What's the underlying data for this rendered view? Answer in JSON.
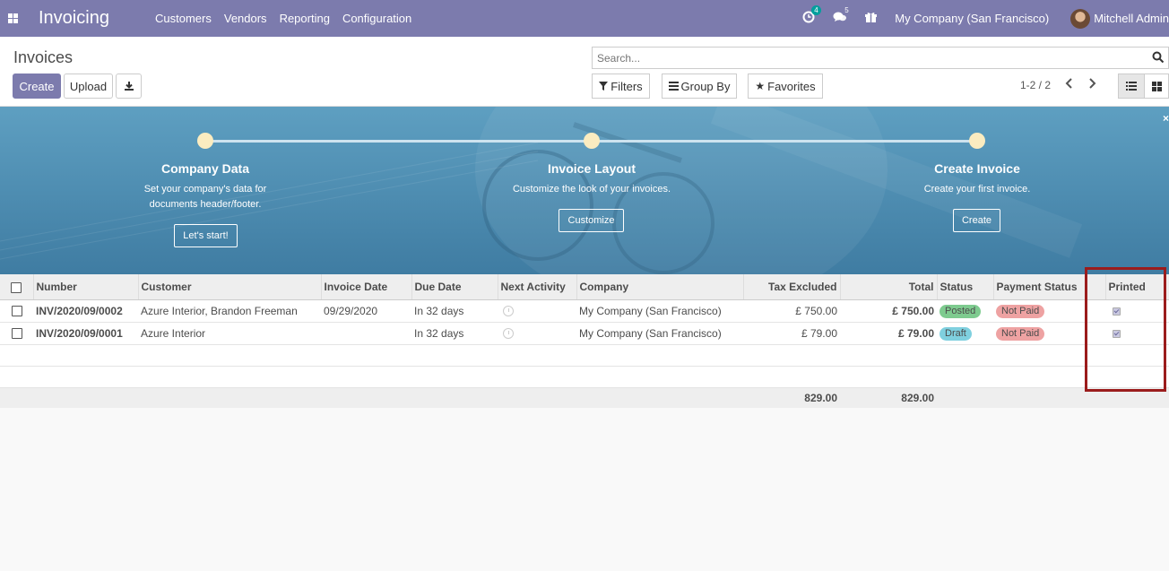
{
  "navbar": {
    "app_title": "Invoicing",
    "menu": [
      "Customers",
      "Vendors",
      "Reporting",
      "Configuration"
    ],
    "activity_count": "4",
    "messages_count": "5",
    "company": "My Company (San Francisco)",
    "user": "Mitchell Admin",
    "accent": "#7c7bad"
  },
  "control": {
    "breadcrumb": "Invoices",
    "create_label": "Create",
    "upload_label": "Upload",
    "search_placeholder": "Search...",
    "filters_label": "Filters",
    "groupby_label": "Group By",
    "favorites_label": "Favorites",
    "pager": "1-2 / 2"
  },
  "banner": {
    "steps": [
      {
        "title": "Company Data",
        "text1": "Set your company's data for",
        "text2": "documents header/footer.",
        "button": "Let's start!"
      },
      {
        "title": "Invoice Layout",
        "text1": "Customize the look of your invoices.",
        "button": "Customize"
      },
      {
        "title": "Create Invoice",
        "text1": "Create your first invoice.",
        "button": "Create"
      }
    ],
    "close": "×"
  },
  "table": {
    "headers": [
      "Number",
      "Customer",
      "Invoice Date",
      "Due Date",
      "Next Activity",
      "Company",
      "Tax Excluded",
      "Total",
      "Status",
      "Payment Status",
      "Printed"
    ],
    "rows": [
      {
        "number": "INV/2020/09/0002",
        "customer": "Azure Interior, Brandon Freeman",
        "invoice_date": "09/29/2020",
        "due_date": "In 32 days",
        "company": "My Company (San Francisco)",
        "tax_excluded": "£ 750.00",
        "total": "£ 750.00",
        "status": "Posted",
        "payment_status": "Not Paid",
        "printed": true
      },
      {
        "number": "INV/2020/09/0001",
        "customer": "Azure Interior",
        "invoice_date": "",
        "due_date": "In 32 days",
        "company": "My Company (San Francisco)",
        "tax_excluded": "£ 79.00",
        "total": "£ 79.00",
        "status": "Draft",
        "payment_status": "Not Paid",
        "printed": true
      }
    ],
    "footer": {
      "tax_excluded": "829.00",
      "total": "829.00"
    },
    "colors": {
      "posted": "#7ecb8f",
      "draft": "#7fd0df",
      "not_paid": "#eea2a2",
      "highlight": "#9b1c1c"
    }
  }
}
